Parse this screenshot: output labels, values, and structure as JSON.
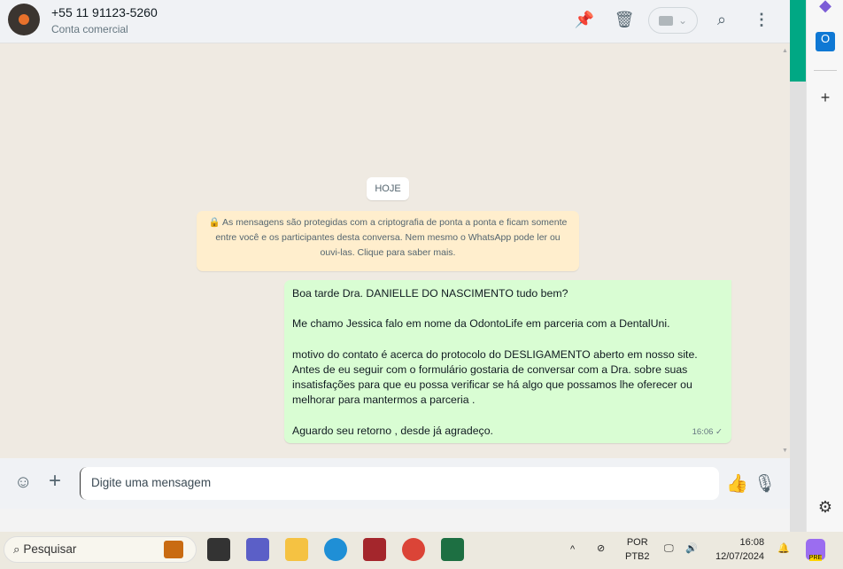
{
  "header": {
    "title": "+55 11 91123-5260",
    "subtitle": "Conta comercial"
  },
  "chat": {
    "day_label": "HOJE",
    "notice": "As mensagens são protegidas com a criptografia de ponta a ponta e ficam somente entre você e os participantes desta conversa. Nem mesmo o WhatsApp pode ler ou ouvi-las. Clique para saber mais.",
    "message": {
      "text": "Boa tarde Dra. DANIELLE DO NASCIMENTO tudo bem?\n\nMe chamo Jessica falo em nome da OdontoLife em parceria com a DentalUni.\n\nmotivo do contato é acerca do protocolo do DESLIGAMENTO aberto em nosso site.\nAntes de eu seguir com o formulário gostaria de conversar com a Dra. sobre suas insatisfações para que eu possa verificar se há algo que possamos lhe oferecer ou melhorar para mantermos a parceria .\n\nAguardo seu retorno , desde já agradeço.",
      "time": "16:06",
      "status": "✓"
    }
  },
  "composer": {
    "placeholder": "Digite uma mensagem"
  },
  "taskbar": {
    "search": "Pesquisar",
    "lang1": "POR",
    "lang2": "PTB2",
    "time": "16:08",
    "date": "12/07/2024",
    "copilot_badge": "PRE"
  }
}
